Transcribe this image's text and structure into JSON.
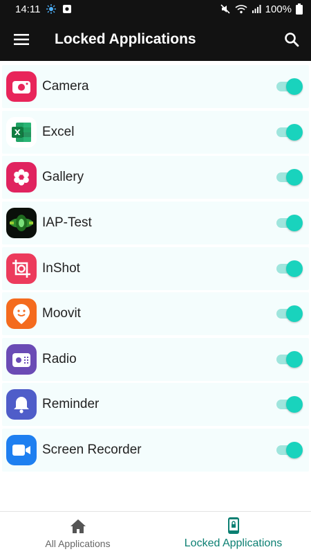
{
  "status_bar": {
    "time": "14:11",
    "battery": "100%",
    "icons": [
      "weather-icon",
      "notification-icon",
      "mute-icon",
      "wifi-icon",
      "signal-icon",
      "battery-icon"
    ]
  },
  "app_bar": {
    "title": "Locked Applications",
    "menu_icon": "hamburger-menu-icon",
    "search_icon": "search-icon"
  },
  "apps": [
    {
      "label": "Camera",
      "icon": "camera-app-icon",
      "color": "#e8255a",
      "locked": true
    },
    {
      "label": "Excel",
      "icon": "excel-app-icon",
      "color": "#1d7044",
      "locked": true
    },
    {
      "label": "Gallery",
      "icon": "gallery-app-icon",
      "color": "#e0235f",
      "locked": true
    },
    {
      "label": "IAP-Test",
      "icon": "iap-test-app-icon",
      "color": "#0a0f0a",
      "locked": true
    },
    {
      "label": "InShot",
      "icon": "inshot-app-icon",
      "color": "#ec3b5c",
      "locked": true
    },
    {
      "label": "Moovit",
      "icon": "moovit-app-icon",
      "color": "#f46b1e",
      "locked": true
    },
    {
      "label": "Radio",
      "icon": "radio-app-icon",
      "color": "#6a4bb5",
      "locked": true
    },
    {
      "label": "Reminder",
      "icon": "reminder-app-icon",
      "color": "#4f5dc9",
      "locked": true
    },
    {
      "label": "Screen Recorder",
      "icon": "screen-recorder-app-icon",
      "color": "#1e7ff0",
      "locked": true
    }
  ],
  "bottom_nav": {
    "tabs": [
      {
        "label": "All Applications",
        "icon": "home-icon",
        "active": false
      },
      {
        "label": "Locked Applications",
        "icon": "locked-phone-icon",
        "active": true
      }
    ]
  },
  "colors": {
    "toolbar": "#121212",
    "row_background": "#f4fdfd",
    "toggle_on": "#19d3bd",
    "toggle_track": "#9fe5dd",
    "active_tab": "#0b7f72"
  }
}
